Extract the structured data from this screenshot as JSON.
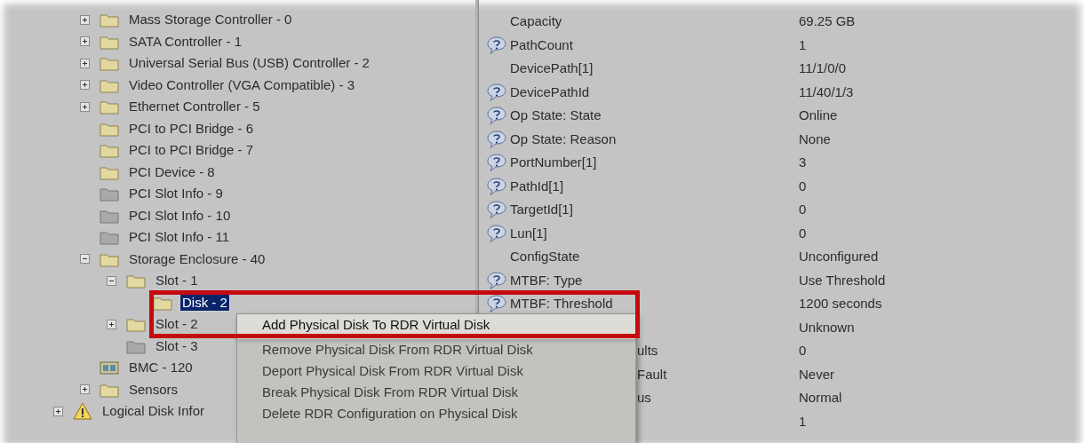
{
  "tree": [
    {
      "children": [
        {
          "label": "Mass Storage Controller - 0",
          "kind": "folder",
          "expanded": false,
          "selected": false
        },
        {
          "label": "SATA Controller - 1",
          "kind": "folder",
          "expanded": false,
          "selected": false
        },
        {
          "label": "Universal Serial Bus (USB) Controller - 2",
          "kind": "folder",
          "expanded": false,
          "selected": false
        },
        {
          "label": "Video Controller (VGA Compatible) - 3",
          "kind": "folder",
          "expanded": false,
          "selected": false
        },
        {
          "label": "Ethernet Controller - 5",
          "kind": "folder",
          "expanded": false,
          "selected": false
        },
        {
          "label": "PCI to PCI Bridge - 6",
          "kind": "folder",
          "selected": false
        },
        {
          "label": "PCI to PCI Bridge - 7",
          "kind": "folder",
          "selected": false
        },
        {
          "label": "PCI Device - 8",
          "kind": "folder",
          "selected": false
        },
        {
          "label": "PCI Slot Info - 9",
          "kind": "empty-folder",
          "selected": false
        },
        {
          "label": "PCI Slot Info - 10",
          "kind": "empty-folder",
          "selected": false
        },
        {
          "label": "PCI Slot Info - 11",
          "kind": "empty-folder",
          "selected": false
        },
        {
          "label": "Storage Enclosure - 40",
          "kind": "folder",
          "expanded": true,
          "selected": false,
          "children": [
            {
              "label": "Slot - 1",
              "kind": "folder",
              "expanded": true,
              "selected": false,
              "children": [
                {
                  "label": "Disk - 2",
                  "kind": "folder",
                  "selected": true
                }
              ]
            },
            {
              "label": "Slot - 2",
              "kind": "folder",
              "expanded": false,
              "selected": false
            },
            {
              "label": "Slot - 3",
              "kind": "empty-folder",
              "selected": false
            }
          ]
        },
        {
          "label": "BMC - 120",
          "kind": "board",
          "selected": false
        },
        {
          "label": "Sensors",
          "kind": "folder",
          "expanded": false,
          "selected": false
        }
      ]
    },
    {
      "label": "Logical Disk Infor",
      "kind": "warning",
      "expanded": false,
      "selected": false
    }
  ],
  "properties": [
    {
      "label": "Capacity",
      "value": "69.25 GB",
      "help": false
    },
    {
      "label": "PathCount",
      "value": "1",
      "help": true
    },
    {
      "label": "DevicePath[1]",
      "value": "11/1/0/0",
      "help": false
    },
    {
      "label": "DevicePathId",
      "value": "11/40/1/3",
      "help": true
    },
    {
      "label": "Op State: State",
      "value": "Online",
      "help": true
    },
    {
      "label": "Op State: Reason",
      "value": "None",
      "help": true
    },
    {
      "label": "PortNumber[1]",
      "value": "3",
      "help": true
    },
    {
      "label": "PathId[1]",
      "value": "0",
      "help": true
    },
    {
      "label": "TargetId[1]",
      "value": "0",
      "help": true
    },
    {
      "label": "Lun[1]",
      "value": "0",
      "help": true
    },
    {
      "label": "ConfigState",
      "value": "Unconfigured",
      "help": false
    },
    {
      "label": "MTBF: Type",
      "value": "Use Threshold",
      "help": true
    },
    {
      "label": "MTBF: Threshold",
      "value": "1200 seconds",
      "help": true
    },
    {
      "value": "Unknown"
    },
    {
      "label": "ults",
      "value": "0",
      "partial": true
    },
    {
      "label": "Fault",
      "value": "Never",
      "partial": true
    },
    {
      "label": "us",
      "value": "Normal",
      "partial": true
    },
    {
      "value": "1"
    }
  ],
  "context_menu": [
    {
      "label": "Add Physical Disk To RDR Virtual Disk",
      "selected": true
    },
    {
      "label": "Remove Physical Disk From RDR Virtual Disk",
      "selected": false
    },
    {
      "label": "Deport Physical Disk From RDR Virtual Disk",
      "selected": false
    },
    {
      "label": "Break Physical Disk From RDR Virtual Disk",
      "selected": false
    },
    {
      "label": "Delete RDR Configuration on Physical Disk",
      "selected": false
    }
  ]
}
